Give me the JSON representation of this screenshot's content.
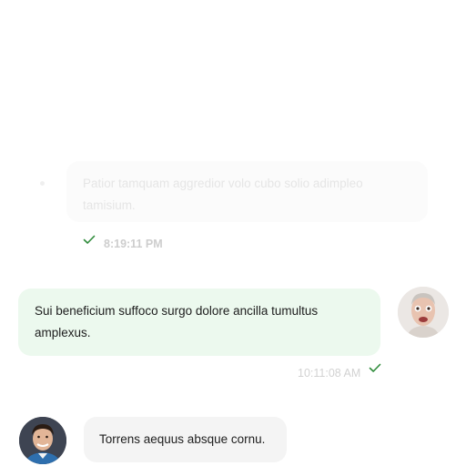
{
  "messages": [
    {
      "id": "m1",
      "direction": "outgoing",
      "faded": true,
      "text": "Patior tamquam aggredior volo cubo solio adimpleo tamisium.",
      "time": "8:19:11 PM",
      "status_icon": "check-icon"
    },
    {
      "id": "m2",
      "direction": "outgoing",
      "faded": false,
      "text": "Sui beneficium suffoco surgo dolore ancilla tumultus amplexus.",
      "time": "10:11:08 AM",
      "status_icon": "check-icon",
      "avatar": "user-avatar"
    },
    {
      "id": "m3",
      "direction": "incoming",
      "faded": false,
      "text": "Torrens aequus absque cornu.",
      "avatar": "contact-avatar"
    }
  ],
  "colors": {
    "sent_bubble": "#ecf9ee",
    "received_bubble": "#f4f4f4",
    "check": "#2e8b3a",
    "timestamp": "#c8c8c8"
  }
}
